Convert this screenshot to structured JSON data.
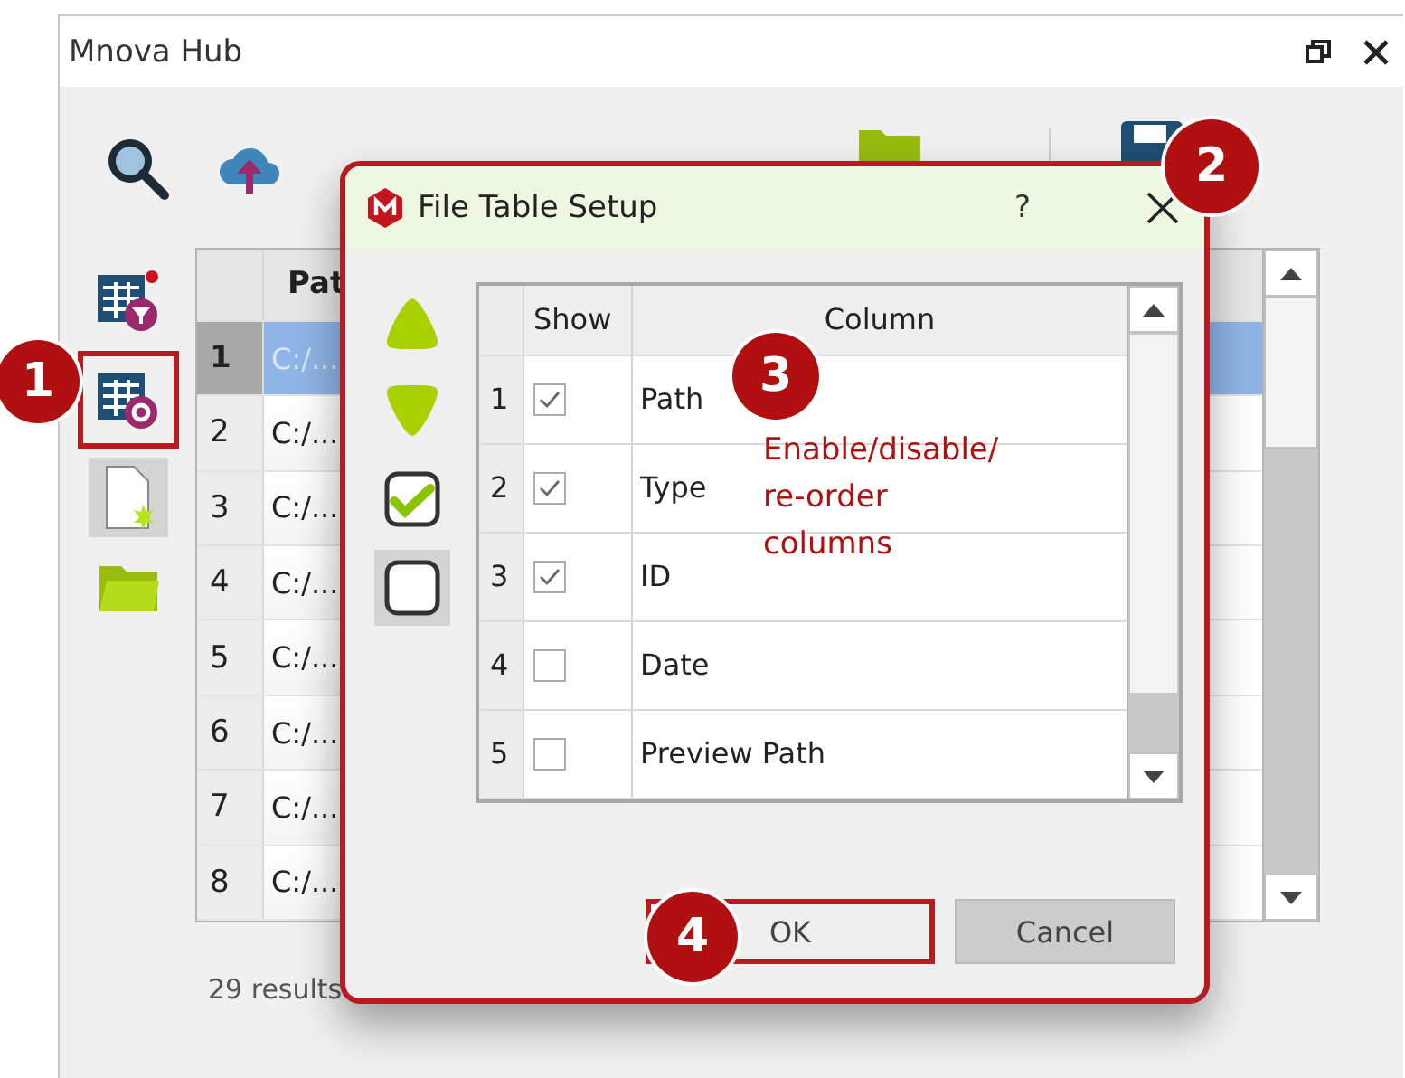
{
  "window": {
    "title": "Mnova Hub"
  },
  "sidebar": {
    "items": [
      {
        "highlighted": false
      },
      {
        "highlighted": true
      },
      {
        "highlighted": false
      },
      {
        "highlighted": false
      }
    ]
  },
  "table": {
    "columns": [
      {
        "label": "Pat"
      }
    ],
    "rows": [
      {
        "number": "1",
        "path": "C:/...",
        "selected": true
      },
      {
        "number": "2",
        "path": "C:/...",
        "selected": false
      },
      {
        "number": "3",
        "path": "C:/...",
        "selected": false
      },
      {
        "number": "4",
        "path": "C:/...",
        "selected": false
      },
      {
        "number": "5",
        "path": "C:/...",
        "selected": false
      },
      {
        "number": "6",
        "path": "C:/...",
        "selected": false
      },
      {
        "number": "7",
        "path": "C:/...",
        "selected": false
      },
      {
        "number": "8",
        "path": "C:/...",
        "selected": false
      }
    ]
  },
  "status_bar": "29 results",
  "dialog": {
    "title": "File Table Setup",
    "help": "?",
    "columns": [
      {
        "label": "Show"
      },
      {
        "label": "Column"
      }
    ],
    "rows": [
      {
        "number": "1",
        "checked": true,
        "name": "Path"
      },
      {
        "number": "2",
        "checked": true,
        "name": "Type"
      },
      {
        "number": "3",
        "checked": true,
        "name": "ID"
      },
      {
        "number": "4",
        "checked": false,
        "name": "Date"
      },
      {
        "number": "5",
        "checked": false,
        "name": "Preview Path"
      }
    ],
    "buttons": [
      {
        "label": "OK",
        "highlighted": true
      },
      {
        "label": "Cancel",
        "highlighted": false
      }
    ]
  },
  "callouts": [
    {
      "number": "1"
    },
    {
      "number": "2"
    },
    {
      "number": "3",
      "text": "Enable/disable/ re-order columns"
    },
    {
      "number": "4"
    }
  ]
}
